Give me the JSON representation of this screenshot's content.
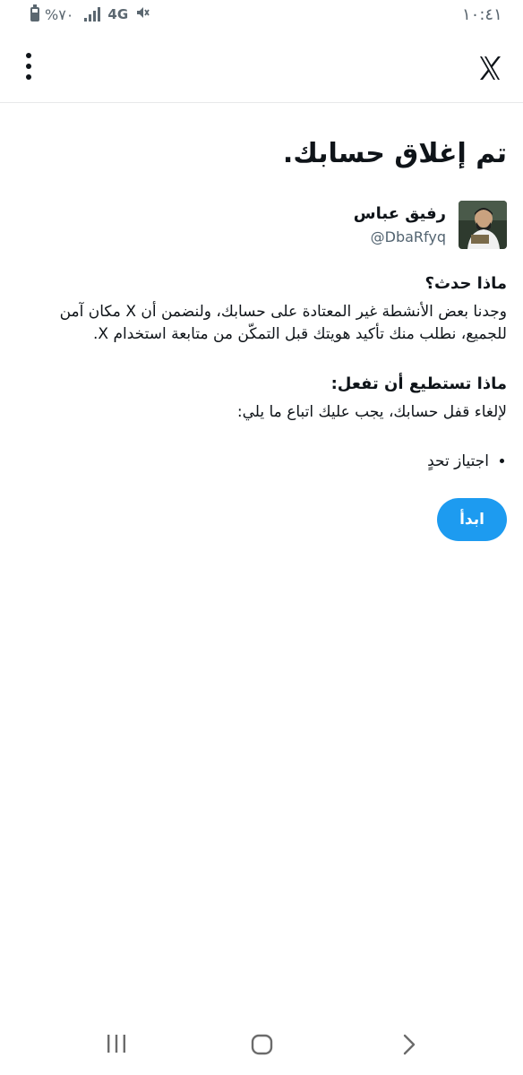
{
  "status_bar": {
    "time": "١٠:٤١",
    "battery_percent": "%٧٠",
    "network": "4G"
  },
  "page": {
    "title": "تم إغلاق حسابك."
  },
  "profile": {
    "name": "رفيق عباس",
    "handle": "@DbaRfyq"
  },
  "sections": {
    "what_happened": {
      "heading": "ماذا حدث؟",
      "text": "وجدنا بعض الأنشطة غير المعتادة على حسابك، ولنضمن أن X مكان آمن للجميع، نطلب منك تأكيد هويتك قبل التمكّن من متابعة استخدام X."
    },
    "what_you_can_do": {
      "heading": "ماذا تستطيع أن تفعل:",
      "text": "لإلغاء قفل حسابك، يجب عليك اتباع ما يلي:",
      "items": [
        "اجتياز تحدٍ"
      ]
    }
  },
  "actions": {
    "start_label": "ابدأ"
  },
  "colors": {
    "accent": "#1d9bf0",
    "text": "#0f1419",
    "muted": "#536471",
    "divider": "#e7e9ea"
  },
  "icons": {
    "close": "x-logo-icon",
    "menu": "more-vertical-icon",
    "nav_recent": "recent-apps-icon",
    "nav_home": "home-icon",
    "nav_back": "back-icon"
  }
}
